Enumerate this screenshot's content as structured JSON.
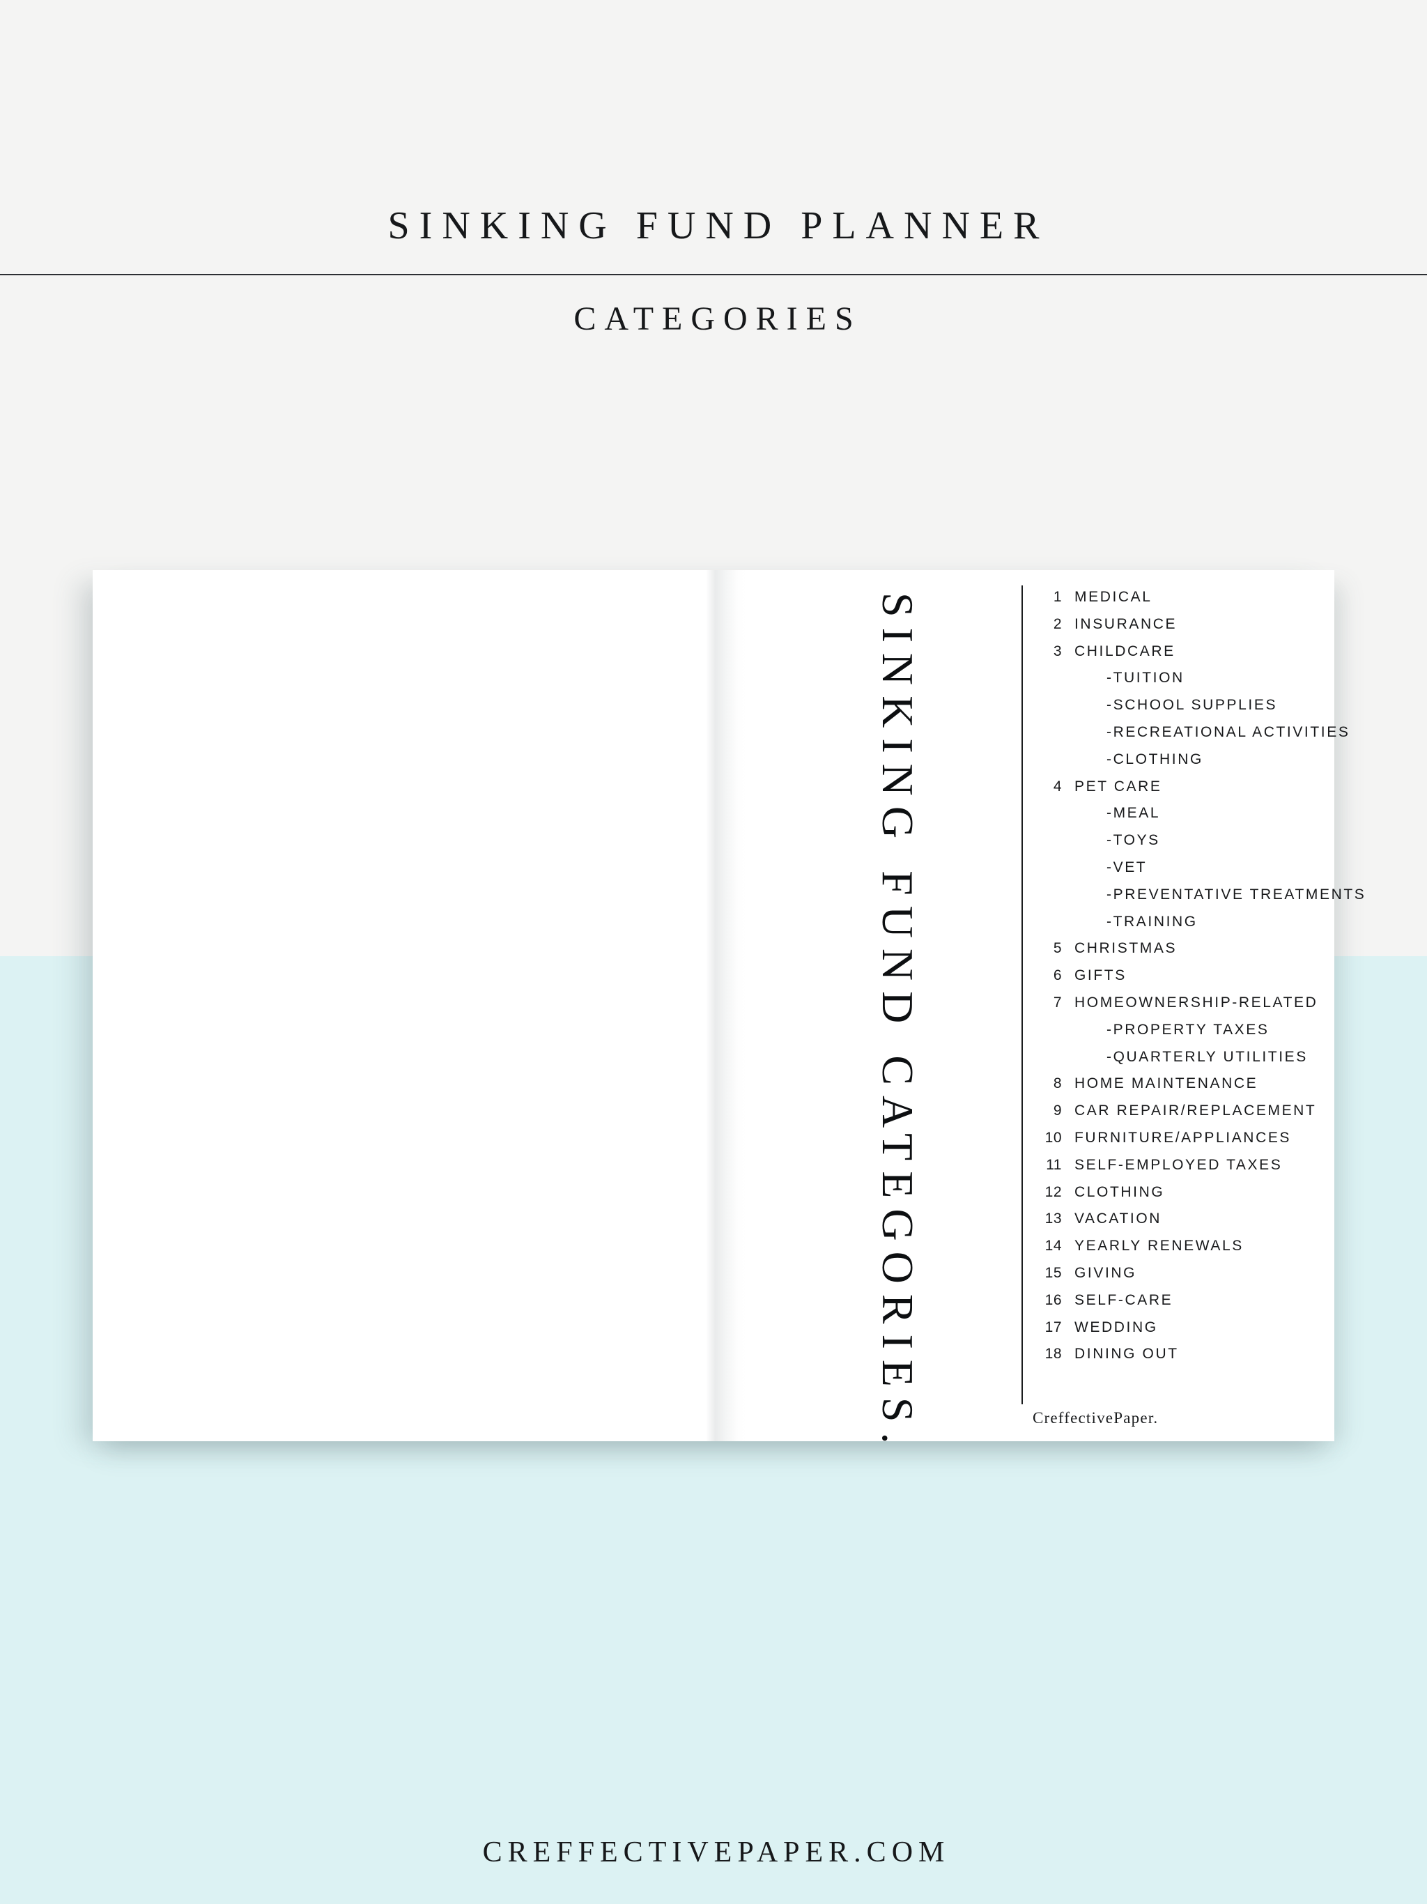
{
  "colors": {
    "background_top": "#f4f4f3",
    "background_bottom": "#dcf2f3",
    "page": "#ffffff",
    "ink": "#16181a"
  },
  "header": {
    "title": "SINKING FUND PLANNER",
    "subtitle": "CATEGORIES"
  },
  "spread": {
    "left_page": {
      "content": ""
    },
    "right_page": {
      "vertical_title": "SINKING FUND CATEGORIES.",
      "brand_mark": "CreffectivePaper.",
      "categories": [
        {
          "number": "1",
          "label": "MEDICAL",
          "sub": false
        },
        {
          "number": "2",
          "label": "INSURANCE",
          "sub": false
        },
        {
          "number": "3",
          "label": "CHILDCARE",
          "sub": false
        },
        {
          "number": "",
          "label": "-TUITION",
          "sub": true
        },
        {
          "number": "",
          "label": "-SCHOOL SUPPLIES",
          "sub": true
        },
        {
          "number": "",
          "label": "-RECREATIONAL ACTIVITIES",
          "sub": true
        },
        {
          "number": "",
          "label": "-CLOTHING",
          "sub": true
        },
        {
          "number": "4",
          "label": "PET CARE",
          "sub": false
        },
        {
          "number": "",
          "label": "-MEAL",
          "sub": true
        },
        {
          "number": "",
          "label": "-TOYS",
          "sub": true
        },
        {
          "number": "",
          "label": "-VET",
          "sub": true
        },
        {
          "number": "",
          "label": "-PREVENTATIVE TREATMENTS",
          "sub": true
        },
        {
          "number": "",
          "label": "-TRAINING",
          "sub": true
        },
        {
          "number": "5",
          "label": "CHRISTMAS",
          "sub": false
        },
        {
          "number": "6",
          "label": "GIFTS",
          "sub": false
        },
        {
          "number": "7",
          "label": "HOMEOWNERSHIP-RELATED",
          "sub": false
        },
        {
          "number": "",
          "label": "-PROPERTY TAXES",
          "sub": true
        },
        {
          "number": "",
          "label": "-QUARTERLY UTILITIES",
          "sub": true
        },
        {
          "number": "8",
          "label": "HOME MAINTENANCE",
          "sub": false
        },
        {
          "number": "9",
          "label": "CAR REPAIR/REPLACEMENT",
          "sub": false
        },
        {
          "number": "10",
          "label": "FURNITURE/APPLIANCES",
          "sub": false
        },
        {
          "number": "11",
          "label": "SELF-EMPLOYED TAXES",
          "sub": false
        },
        {
          "number": "12",
          "label": "CLOTHING",
          "sub": false
        },
        {
          "number": "13",
          "label": "VACATION",
          "sub": false
        },
        {
          "number": "14",
          "label": "YEARLY RENEWALS",
          "sub": false
        },
        {
          "number": "15",
          "label": "GIVING",
          "sub": false
        },
        {
          "number": "16",
          "label": "SELF-CARE",
          "sub": false
        },
        {
          "number": "17",
          "label": "WEDDING",
          "sub": false
        },
        {
          "number": "18",
          "label": "DINING OUT",
          "sub": false
        }
      ]
    }
  },
  "footer": {
    "url": "CREFFECTIVEPAPER.COM"
  }
}
